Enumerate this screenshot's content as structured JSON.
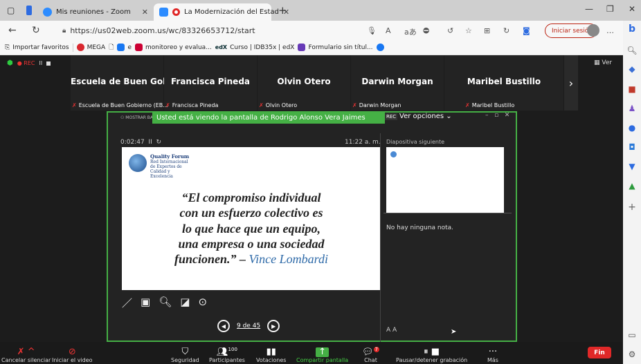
{
  "browser": {
    "tabs": [
      {
        "title": "Mis reuniones - Zoom",
        "active": false,
        "icon": "zoom-icon",
        "icon_color": "#2d8cff"
      },
      {
        "title": "La Modernización del Estad",
        "active": true,
        "icon": "zoom-recording-icon",
        "icon_color": "#e02828"
      }
    ],
    "new_tab": "+",
    "url": "https://us02web.zoom.us/wc/83326653712/start",
    "signin_label": "Iniciar sesión",
    "more_label": "…",
    "favorites": [
      {
        "label": "Importar favoritos",
        "icon": "import-icon"
      },
      {
        "label": "MEGA",
        "icon": "mega-icon",
        "color": "#d9272e"
      },
      {
        "label": "",
        "icon": "page-icon"
      },
      {
        "label": "e",
        "icon": "facebook-icon",
        "color": "#1877f2"
      },
      {
        "label": "monitoreo y evalua...",
        "icon": "doc-icon",
        "color": "#c03"
      },
      {
        "label": "Curso | IDB35x | edX",
        "icon": "edx-icon",
        "color": "#02262b"
      },
      {
        "label": "Formulario sin títul...",
        "icon": "forms-icon",
        "color": "#673ab7"
      }
    ]
  },
  "zoom": {
    "rec_label": "● REC",
    "pause_label": "II",
    "view_label": "Ver",
    "participants": [
      {
        "name": "Escuela de Buen Gobie...",
        "label": "Escuela de Buen Gobierno (EB..."
      },
      {
        "name": "Francisca Pineda",
        "label": "Francisca Pineda"
      },
      {
        "name": "Olvin Otero",
        "label": "Olvin Otero"
      },
      {
        "name": "Darwin Morgan",
        "label": "Darwin Morgan"
      },
      {
        "name": "Maribel Bustillo",
        "label": "Maribel Bustillo"
      }
    ],
    "share": {
      "banner": "Usted está viendo la pantalla de Rodrigo Alonso Vera Jaimes",
      "rec_mini": "REC",
      "view_options": "Ver opciones ⌄",
      "show_bar": "MOSTRAR BARRA DE T",
      "elapsed": "0:02:47",
      "clock": "11:22 a. m.",
      "next_slide_label": "Diapositiva siguiente",
      "notes": "No hay ninguna nota.",
      "page": "9 de 45",
      "font_buttons": "A  A",
      "slide": {
        "logo_title": "Quality Forum",
        "logo_sub": "Red Internacional de Expertos de Calidad y Excelencia",
        "quote_lines": [
          "“El compromiso individual",
          "con un esfuerzo colectivo es",
          "lo que hace que un equipo,",
          "una empresa o una sociedad",
          "funcionen.” –"
        ],
        "author": "Vince Lombardi"
      }
    },
    "toolbar": [
      {
        "label": "Cancelar silenciar",
        "icon": "mic-muted-icon"
      },
      {
        "label": "Iniciar el video",
        "icon": "video-off-icon"
      },
      {
        "label": "Seguridad",
        "icon": "shield-icon"
      },
      {
        "label": "Participantes",
        "icon": "participants-icon",
        "count": "100"
      },
      {
        "label": "Votaciones",
        "icon": "polls-icon"
      },
      {
        "label": "Compartir pantalla",
        "icon": "share-screen-icon"
      },
      {
        "label": "Chat",
        "icon": "chat-icon",
        "badge": "7"
      },
      {
        "label": "Pausar/detener grabación",
        "icon": "pause-stop-icon"
      },
      {
        "label": "Más",
        "icon": "more-icon"
      }
    ],
    "end_label": "Fin",
    "share_green": "#45b045",
    "end_red": "#e02828"
  }
}
